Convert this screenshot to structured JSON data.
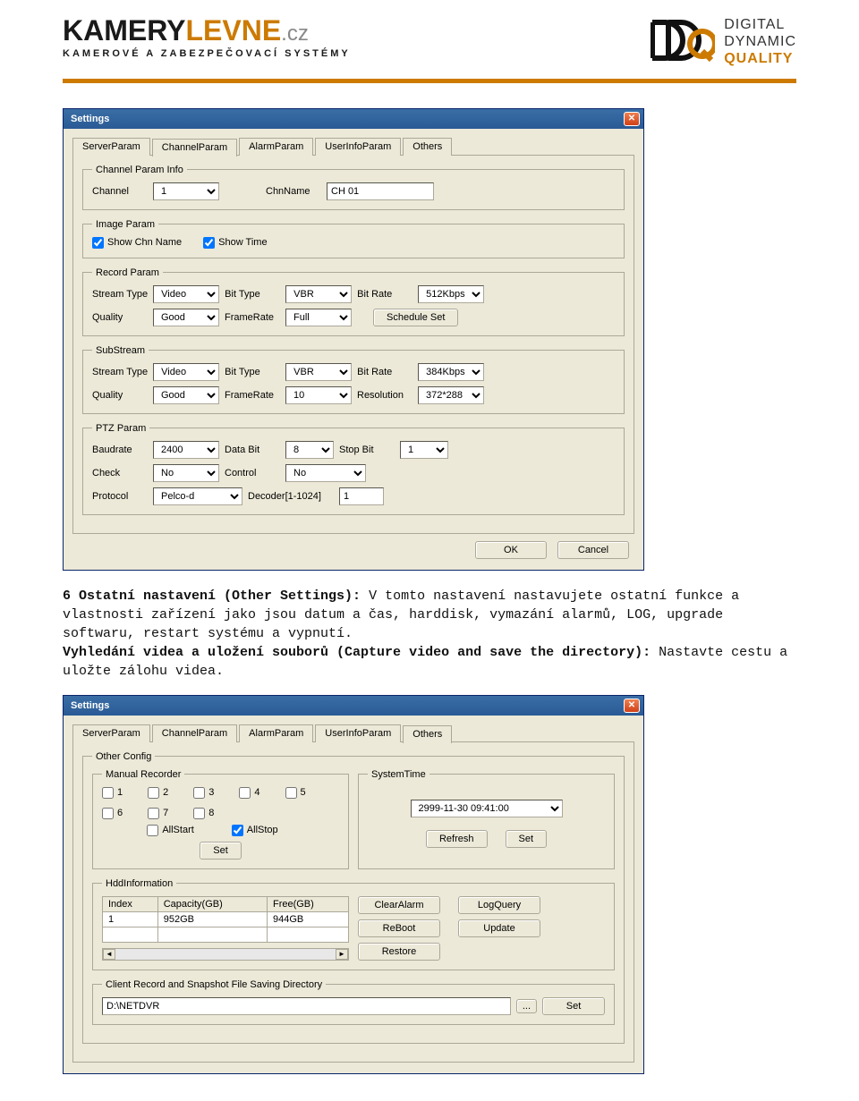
{
  "header": {
    "logo_k": "KAMERY",
    "logo_l": "LEVNE",
    "logo_cz": ".cz",
    "logo_sub": "KAMEROVÉ A ZABEZPEČOVACÍ SYSTÉMY",
    "ddq1": "DIGITAL",
    "ddq2": "DYNAMIC",
    "ddq3": "QUALITY"
  },
  "dlg1": {
    "title": "Settings",
    "tabs": [
      "ServerParam",
      "ChannelParam",
      "AlarmParam",
      "UserInfoParam",
      "Others"
    ],
    "groups": {
      "cpi": "Channel Param Info",
      "ip": "Image Param",
      "rp": "Record Param",
      "ss": "SubStream",
      "ptz": "PTZ Param"
    },
    "labels": {
      "channel": "Channel",
      "chnname": "ChnName",
      "showchn": "Show Chn Name",
      "showtime": "Show Time",
      "streamtype": "Stream Type",
      "bittype": "Bit Type",
      "bitrate": "Bit Rate",
      "quality": "Quality",
      "framerate": "FrameRate",
      "scheduleset": "Schedule Set",
      "resolution": "Resolution",
      "baudrate": "Baudrate",
      "databit": "Data Bit",
      "stopbit": "Stop Bit",
      "check": "Check",
      "control": "Control",
      "protocol": "Protocol",
      "decoder": "Decoder[1-1024]"
    },
    "values": {
      "channel": "1",
      "chnname": "CH 01",
      "rp_stream": "Video",
      "rp_bittype": "VBR",
      "rp_bitrate": "512Kbps",
      "rp_quality": "Good",
      "rp_framerate": "Full",
      "ss_stream": "Video",
      "ss_bittype": "VBR",
      "ss_bitrate": "384Kbps",
      "ss_quality": "Good",
      "ss_framerate": "10",
      "ss_resolution": "372*288",
      "baudrate": "2400",
      "databit": "8",
      "stopbit": "1",
      "check": "No",
      "control": "No",
      "protocol": "Pelco-d",
      "decoder": "1"
    },
    "buttons": {
      "ok": "OK",
      "cancel": "Cancel"
    }
  },
  "paragraph": {
    "h6": "6 Ostatní nastavení (Other Settings):",
    "p6": " V tomto nastavení nastavujete ostatní funkce a vlastnosti zařízení jako jsou datum a čas, harddisk, vymazání alarmů, LOG, upgrade softwaru, restart systému a vypnutí.",
    "h7": "Vyhledání videa a uložení souborů (Capture video and save the directory):",
    "p7": " Nastavte cestu a uložte zálohu videa."
  },
  "dlg2": {
    "title": "Settings",
    "tabs": [
      "ServerParam",
      "ChannelParam",
      "AlarmParam",
      "UserInfoParam",
      "Others"
    ],
    "groups": {
      "oc": "Other Config",
      "mr": "Manual Recorder",
      "st": "SystemTime",
      "hi": "HddInformation",
      "cr": "Client Record and Snapshot File Saving Directory"
    },
    "mr_channels": [
      "1",
      "2",
      "3",
      "4",
      "5",
      "6",
      "7",
      "8"
    ],
    "mr_allstart": "AllStart",
    "mr_allstop": "AllStop",
    "mr_set": "Set",
    "st_value": "2999-11-30    09:41:00",
    "st_refresh": "Refresh",
    "st_set": "Set",
    "hdd_cols": [
      "Index",
      "Capacity(GB)",
      "Free(GB)"
    ],
    "hdd_row": [
      "1",
      "952GB",
      "944GB"
    ],
    "btns": {
      "clearalarm": "ClearAlarm",
      "logquery": "LogQuery",
      "reboot": "ReBoot",
      "update": "Update",
      "restore": "Restore"
    },
    "path_value": "D:\\NETDVR",
    "browse": "...",
    "set": "Set"
  }
}
